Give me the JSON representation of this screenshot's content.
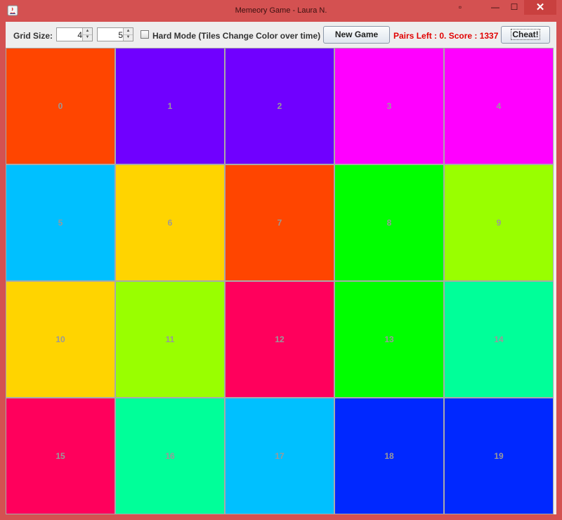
{
  "window": {
    "title": "Memeory Game - Laura N.",
    "close_glyph": "✕",
    "minimize_glyph": "—",
    "maximize_glyph": "☐",
    "restore_glyph": "▫"
  },
  "toolbar": {
    "grid_size_label": "Grid Size:",
    "rows_value": "4",
    "cols_value": "5",
    "hard_mode_checked": false,
    "hard_mode_label": "Hard Mode (Tiles Change Color over time)",
    "new_game_label": "New Game",
    "status_text": "Pairs Left : 0. Score : 1337",
    "cheat_label": "Cheat!"
  },
  "colors": {
    "status": "#e00000",
    "window_frame": "#d45151"
  },
  "board": {
    "rows": 4,
    "cols": 5,
    "tiles": [
      {
        "label": "0",
        "color": "#ff4500"
      },
      {
        "label": "1",
        "color": "#7000ff"
      },
      {
        "label": "2",
        "color": "#7000ff"
      },
      {
        "label": "3",
        "color": "#ff00ff"
      },
      {
        "label": "4",
        "color": "#ff00ff"
      },
      {
        "label": "5",
        "color": "#00c0ff"
      },
      {
        "label": "6",
        "color": "#ffd400"
      },
      {
        "label": "7",
        "color": "#ff4500"
      },
      {
        "label": "8",
        "color": "#00ff00"
      },
      {
        "label": "9",
        "color": "#99ff00"
      },
      {
        "label": "10",
        "color": "#ffd400"
      },
      {
        "label": "11",
        "color": "#99ff00"
      },
      {
        "label": "12",
        "color": "#ff005c"
      },
      {
        "label": "13",
        "color": "#00ff00"
      },
      {
        "label": "14",
        "color": "#00ff99"
      },
      {
        "label": "15",
        "color": "#ff005c"
      },
      {
        "label": "16",
        "color": "#00ff99"
      },
      {
        "label": "17",
        "color": "#00c0ff"
      },
      {
        "label": "18",
        "color": "#0028ff"
      },
      {
        "label": "19",
        "color": "#0028ff"
      }
    ]
  }
}
